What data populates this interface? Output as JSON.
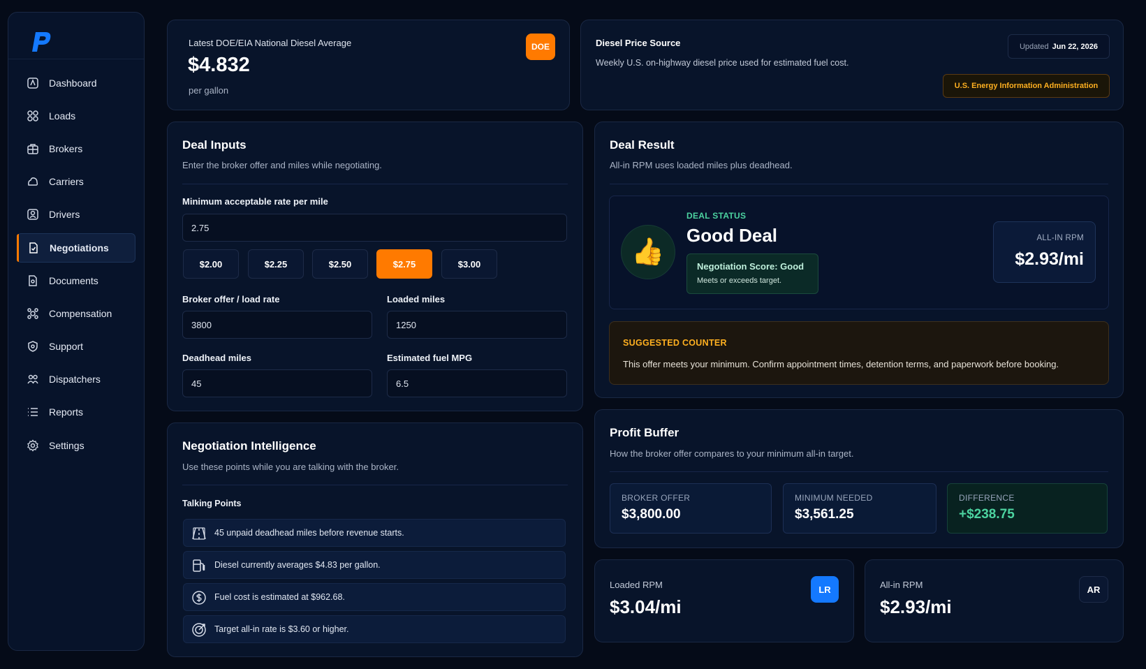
{
  "sidebar": {
    "logo_letter": "P",
    "items": [
      {
        "label": "Dashboard",
        "icon": "dashboard-icon"
      },
      {
        "label": "Loads",
        "icon": "loads-icon"
      },
      {
        "label": "Brokers",
        "icon": "brokers-icon"
      },
      {
        "label": "Carriers",
        "icon": "carriers-icon"
      },
      {
        "label": "Drivers",
        "icon": "drivers-icon"
      },
      {
        "label": "Negotiations",
        "icon": "negotiations-icon",
        "active": true
      },
      {
        "label": "Documents",
        "icon": "documents-icon"
      },
      {
        "label": "Compensation",
        "icon": "compensation-icon"
      },
      {
        "label": "Support",
        "icon": "support-icon"
      },
      {
        "label": "Dispatchers",
        "icon": "dispatchers-icon"
      },
      {
        "label": "Reports",
        "icon": "reports-icon"
      },
      {
        "label": "Settings",
        "icon": "settings-icon"
      }
    ]
  },
  "diesel": {
    "title": "Latest DOE/EIA National Diesel Average",
    "price": "$4.832",
    "unit": "per gallon",
    "badge": "DOE"
  },
  "source": {
    "title": "Diesel Price Source",
    "description": "Weekly U.S. on-highway diesel price used for estimated fuel cost.",
    "updated_label": "Updated",
    "updated_date": "Jun 22, 2026",
    "agency": "U.S. Energy Information Administration"
  },
  "inputs": {
    "title": "Deal Inputs",
    "subtitle": "Enter the broker offer and miles while negotiating.",
    "min_rate_label": "Minimum acceptable rate per mile",
    "min_rate_value": "2.75",
    "presets": [
      "$2.00",
      "$2.25",
      "$2.50",
      "$2.75",
      "$3.00"
    ],
    "active_preset": 3,
    "broker_offer_label": "Broker offer / load rate",
    "broker_offer_value": "3800",
    "loaded_miles_label": "Loaded miles",
    "loaded_miles_value": "1250",
    "deadhead_label": "Deadhead miles",
    "deadhead_value": "45",
    "mpg_label": "Estimated fuel MPG",
    "mpg_value": "6.5"
  },
  "intel": {
    "title": "Negotiation Intelligence",
    "subtitle": "Use these points while you are talking with the broker.",
    "talking_title": "Talking Points",
    "points": [
      {
        "text": "45 unpaid deadhead miles before revenue starts.",
        "icon": "road-icon"
      },
      {
        "text": "Diesel currently averages $4.83 per gallon.",
        "icon": "fuel-pump-icon"
      },
      {
        "text": "Fuel cost is estimated at $962.68.",
        "icon": "dollar-icon"
      },
      {
        "text": "Target all-in rate is $3.60 or higher.",
        "icon": "target-icon"
      }
    ]
  },
  "result": {
    "title": "Deal Result",
    "subtitle": "All-in RPM uses loaded miles plus deadhead.",
    "status_label": "DEAL STATUS",
    "status": "Good Deal",
    "emoji": "👍",
    "score_title": "Negotiation Score: Good",
    "score_sub": "Meets or exceeds target.",
    "rpm_label": "ALL-IN RPM",
    "rpm_value": "$2.93/mi",
    "counter_title": "SUGGESTED COUNTER",
    "counter_text": "This offer meets your minimum. Confirm appointment times, detention terms, and paperwork before booking."
  },
  "buffer": {
    "title": "Profit Buffer",
    "subtitle": "How the broker offer compares to your minimum all-in target.",
    "broker_offer_label": "BROKER OFFER",
    "broker_offer_value": "$3,800.00",
    "min_needed_label": "MINIMUM NEEDED",
    "min_needed_value": "$3,561.25",
    "difference_label": "DIFFERENCE",
    "difference_value": "+$238.75"
  },
  "loaded_rpm": {
    "label": "Loaded RPM",
    "value": "$3.04/mi",
    "badge": "LR"
  },
  "allin_rpm": {
    "label": "All-in RPM",
    "value": "$2.93/mi",
    "badge": "AR"
  },
  "colors": {
    "accent": "#ff7a00",
    "primary_blue": "#1479ff",
    "success": "#4cd3a0",
    "warning": "#ffb020",
    "background": "#050b18"
  }
}
